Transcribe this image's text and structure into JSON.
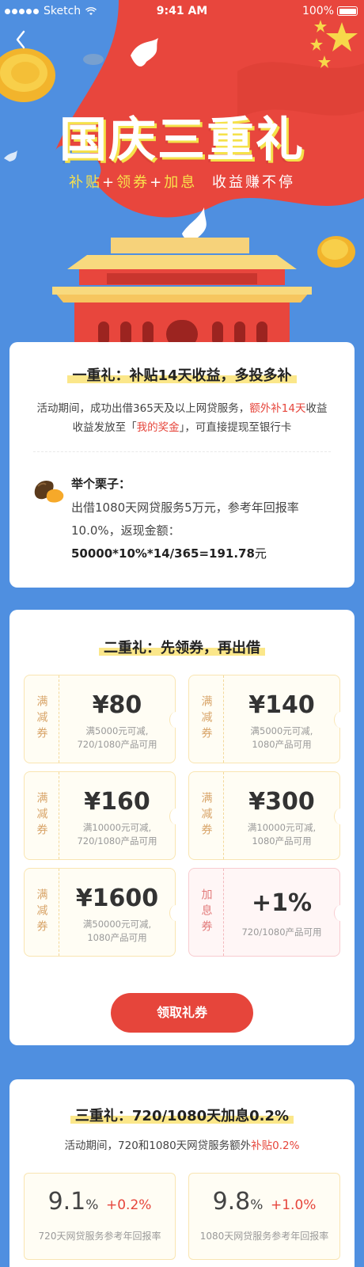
{
  "status_bar": {
    "carrier": "Sketch",
    "time": "9:41 AM",
    "battery": "100%"
  },
  "hero": {
    "title": "国庆三重礼",
    "subtitle": {
      "p1": "补贴",
      "plus1": "+",
      "p2": "领券",
      "plus2": "+",
      "p3": "加息",
      "p4": "收益赚不停"
    }
  },
  "gift1": {
    "title": "一重礼：补贴14天收益，多投多补",
    "desc_line1_a": "活动期间，成功出借365天及以上网贷服务，",
    "desc_line1_b": "额外补14天",
    "desc_line1_c": "收益",
    "desc_line2_a": "收益发放至「",
    "desc_line2_b": "我的奖金",
    "desc_line2_c": "」，可直接提现至银行卡",
    "example_title": "举个栗子：",
    "example_text": "出借1080天网贷服务5万元，参考年回报率10.0%，返现金额：",
    "formula_a": "50000*10%*14/365=191.78",
    "formula_b": "元"
  },
  "gift2": {
    "title": "二重礼：先领券，再出借",
    "coupons": [
      {
        "type": "满减券",
        "amount": "¥80",
        "cond1": "满5000元可减,",
        "cond2": "720/1080产品可用"
      },
      {
        "type": "满减券",
        "amount": "¥140",
        "cond1": "满5000元可减,",
        "cond2": "1080产品可用"
      },
      {
        "type": "满减券",
        "amount": "¥160",
        "cond1": "满10000元可减,",
        "cond2": "720/1080产品可用"
      },
      {
        "type": "满减券",
        "amount": "¥300",
        "cond1": "满10000元可减,",
        "cond2": "1080产品可用"
      },
      {
        "type": "满减券",
        "amount": "¥1600",
        "cond1": "满50000元可减,",
        "cond2": "1080产品可用"
      },
      {
        "type": "加息券",
        "amount": "+1%",
        "cond1": "720/1080产品可用",
        "cond2": ""
      }
    ],
    "button": "领取礼券"
  },
  "gift3": {
    "title": "三重礼：720/1080天加息0.2%",
    "desc_a": "活动期间，720和1080天网贷服务额外",
    "desc_b": "补贴0.2%",
    "rates": [
      {
        "value": "9.1",
        "unit": "%",
        "plus": "+0.2%",
        "label": "720天网贷服务参考年回报率"
      },
      {
        "value": "9.8",
        "unit": "%",
        "plus": "+1.0%",
        "label": "1080天网贷服务参考年回报率"
      }
    ]
  },
  "colors": {
    "accent_red": "#e6453b",
    "bg_blue": "#4f8fe0",
    "yellow": "#f9e24c",
    "coupon_border": "#f9e5b2"
  }
}
